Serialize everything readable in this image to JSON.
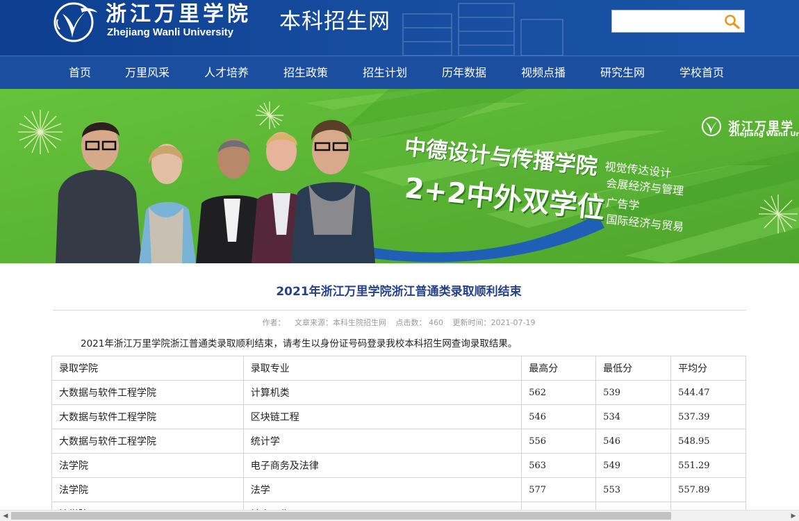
{
  "header": {
    "logo_cn": "浙江万里学院",
    "logo_en": "Zhejiang Wanli University",
    "site_name": "本科招生网",
    "search_value": ""
  },
  "nav": [
    {
      "label": "首页",
      "id": "home"
    },
    {
      "label": "万里风采",
      "id": "wanli-style"
    },
    {
      "label": "人才培养",
      "id": "talent-training"
    },
    {
      "label": "招生政策",
      "id": "admission-policy"
    },
    {
      "label": "招生计划",
      "id": "admission-plan"
    },
    {
      "label": "历年数据",
      "id": "historical-data"
    },
    {
      "label": "视频点播",
      "id": "video-on-demand"
    },
    {
      "label": "研究生网",
      "id": "graduate-site"
    },
    {
      "label": "学校首页",
      "id": "school-home"
    }
  ],
  "banner": {
    "line1": "中德设计与传播学院",
    "line2": "2+2中外双学位",
    "majors": [
      "视觉传达设计",
      "会展经济与管理",
      "广告学",
      "国际经济与贸易"
    ],
    "logo_cn": "浙江万里学",
    "logo_en": "Zhejiang Wanli Univer"
  },
  "article": {
    "title": "2021年浙江万里学院浙江普通类录取顺利结束",
    "meta": {
      "author": "作者：",
      "source": "文章来源：本科生院招生网",
      "hits": "点击数： 460",
      "updated": "更新时间：2021-07-19"
    },
    "intro": "2021年浙江万里学院浙江普通类录取顺利结束，请考生以身份证号码登录我校本科招生网查询录取结果。"
  },
  "table": {
    "headers": [
      "录取学院",
      "录取专业",
      "最高分",
      "最低分",
      "平均分"
    ],
    "rows": [
      [
        "大数据与软件工程学院",
        "计算机类",
        "562",
        "539",
        "544.47"
      ],
      [
        "大数据与软件工程学院",
        "区块链工程",
        "546",
        "534",
        "537.39"
      ],
      [
        "大数据与软件工程学院",
        "统计学",
        "556",
        "546",
        "548.95"
      ],
      [
        "法学院",
        "电子商务及法律",
        "563",
        "549",
        "551.29"
      ],
      [
        "法学院",
        "法学",
        "577",
        "553",
        "557.89"
      ],
      [
        "法学院",
        "社会工作",
        "",
        "",
        ""
      ]
    ]
  },
  "colors": {
    "header_bg": "#164c9e",
    "nav_bg": "#1b4e9f",
    "title": "#25418a",
    "banner_green": "#5ab536"
  },
  "icons": {
    "search": "magnifier-icon",
    "logo": "wanli-emblem-icon"
  },
  "scrollbar": {
    "position_fraction": 0,
    "visible_fraction": 0.85
  }
}
